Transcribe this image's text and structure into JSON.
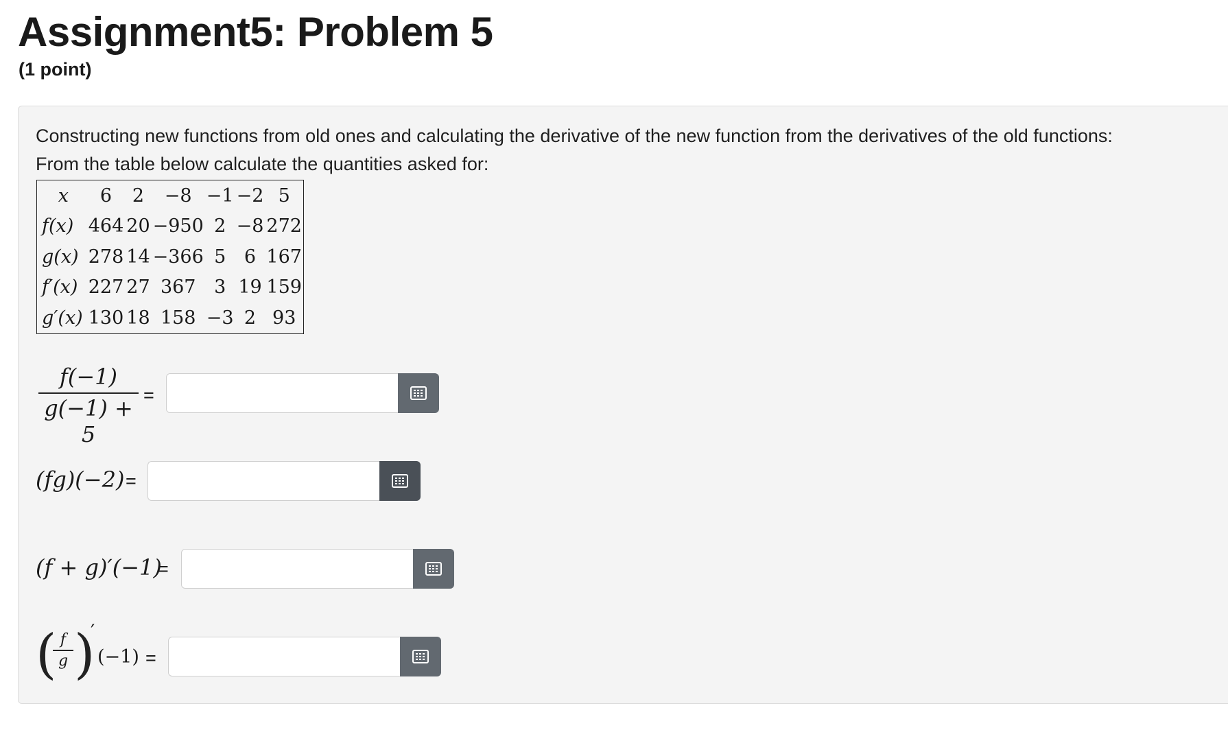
{
  "header": {
    "title": "Assignment5: Problem 5",
    "points": "(1 point)"
  },
  "problem": {
    "intro_line1": "Constructing new functions from old ones and calculating the derivative of the new function from the derivatives of the old functions:",
    "intro_line2": "From the table below calculate the quantities asked for:",
    "table": {
      "header_label": "x",
      "columns": [
        "6",
        "2",
        "−8",
        "−1",
        "−2",
        "5"
      ],
      "rows": [
        {
          "label": "f(x)",
          "values": [
            "464",
            "20",
            "−950",
            "2",
            "−8",
            "272"
          ]
        },
        {
          "label": "g(x)",
          "values": [
            "278",
            "14",
            "−366",
            "5",
            "6",
            "167"
          ]
        },
        {
          "label": "f′(x)",
          "values": [
            "227",
            "27",
            "367",
            "3",
            "19",
            "159"
          ]
        },
        {
          "label": "g′(x)",
          "values": [
            "130",
            "18",
            "158",
            "−3",
            "2",
            "93"
          ]
        }
      ]
    },
    "questions": [
      {
        "numerator": "f(−1)",
        "denominator": "g(−1) + 5",
        "equals": "=",
        "value": "",
        "button_icon": "keypad-icon"
      },
      {
        "label": "(fg)(−2)",
        "equals": "=",
        "value": "",
        "button_icon": "keypad-icon"
      },
      {
        "label": "(f + g)′(−1)",
        "equals": "=",
        "value": "",
        "button_icon": "keypad-icon"
      },
      {
        "frac_num": "f",
        "frac_den": "g",
        "prime": "′",
        "arg": "(−1)",
        "equals": "=",
        "value": "",
        "button_icon": "keypad-icon"
      }
    ]
  }
}
